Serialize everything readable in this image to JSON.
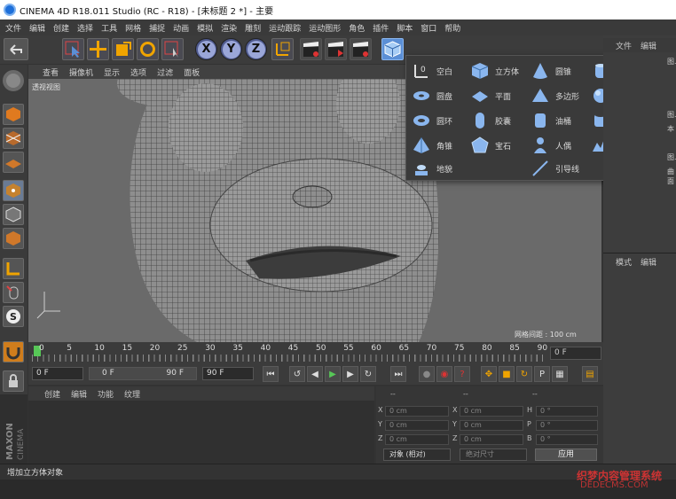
{
  "window": {
    "title": "CINEMA 4D R18.011 Studio (RC - R18) - [未标题 2 *] - 主要"
  },
  "menubar": [
    "文件",
    "编辑",
    "创建",
    "选择",
    "工具",
    "网格",
    "捕捉",
    "动画",
    "模拟",
    "渲染",
    "雕刻",
    "运动跟踪",
    "运动图形",
    "角色",
    "插件",
    "脚本",
    "窗口",
    "帮助"
  ],
  "toolbar": {
    "axis_x": "X",
    "axis_y": "Y",
    "axis_z": "Z"
  },
  "viewport": {
    "menu": [
      "查看",
      "摄像机",
      "显示",
      "选项",
      "过滤",
      "面板"
    ],
    "title": "透视视图",
    "grid_label": "网格间距 : 100 cm"
  },
  "primitives_menu": [
    {
      "label": "空白",
      "icon": "null-icon"
    },
    {
      "label": "立方体",
      "icon": "cube-icon"
    },
    {
      "label": "圆锥",
      "icon": "cone-icon"
    },
    {
      "label": "圆柱",
      "icon": "cylinder-icon"
    },
    {
      "label": "圆盘",
      "icon": "disc-icon"
    },
    {
      "label": "平面",
      "icon": "plane-icon"
    },
    {
      "label": "多边形",
      "icon": "polygon-icon"
    },
    {
      "label": "球体",
      "icon": "sphere-icon"
    },
    {
      "label": "圆环",
      "icon": "torus-icon"
    },
    {
      "label": "胶囊",
      "icon": "capsule-icon"
    },
    {
      "label": "油桶",
      "icon": "oiltank-icon"
    },
    {
      "label": "管道",
      "icon": "tube-icon"
    },
    {
      "label": "角锥",
      "icon": "pyramid-icon"
    },
    {
      "label": "宝石",
      "icon": "platonic-icon"
    },
    {
      "label": "人偶",
      "icon": "figure-icon"
    },
    {
      "label": "地形",
      "icon": "landscape-icon"
    },
    {
      "label": "地貌",
      "icon": "relief-icon"
    },
    {
      "label": "",
      "icon": ""
    },
    {
      "label": "引导线",
      "icon": "guide-icon"
    },
    {
      "label": "",
      "icon": ""
    }
  ],
  "object_panel": {
    "tabs": [
      "文件",
      "编辑"
    ],
    "partial_rows": [
      "图.3",
      "图.1",
      "本",
      "图.2",
      "曲面"
    ]
  },
  "attribute_panel": {
    "tabs": [
      "模式",
      "编辑"
    ]
  },
  "timeline": {
    "ticks": [
      "0",
      "5",
      "10",
      "15",
      "20",
      "25",
      "30",
      "35",
      "40",
      "45",
      "50",
      "55",
      "60",
      "65",
      "70",
      "75",
      "80",
      "85",
      "90"
    ],
    "current_frame": "0 F"
  },
  "transport": {
    "start_field": "0 F",
    "range_start": "0 F",
    "range_end": "90 F",
    "end_field": "90 F"
  },
  "material_panel": {
    "menu": [
      "创建",
      "编辑",
      "功能",
      "纹理"
    ]
  },
  "coordinates": {
    "header": [
      "--",
      "--",
      "--"
    ],
    "rows": [
      {
        "a_label": "X",
        "a_value": "0 cm",
        "b_label": "X",
        "b_value": "0 cm",
        "c_label": "H",
        "c_value": "0 °"
      },
      {
        "a_label": "Y",
        "a_value": "0 cm",
        "b_label": "Y",
        "b_value": "0 cm",
        "c_label": "P",
        "c_value": "0 °"
      },
      {
        "a_label": "Z",
        "a_value": "0 cm",
        "b_label": "Z",
        "b_value": "0 cm",
        "c_label": "B",
        "c_value": "0 °"
      }
    ],
    "mode_select": "对象 (相对)",
    "size_select": "绝对尺寸",
    "apply_label": "应用"
  },
  "logo": "MAXON CINEMA",
  "statusbar": {
    "text": "增加立方体对象"
  },
  "watermark": {
    "line1": "织梦内容管理系统",
    "line2": "DEDECMS.COM"
  },
  "colors": {
    "accent": "#5b8fd6",
    "viewport_bg": "#6a6a6a",
    "play_green": "#57c757"
  }
}
